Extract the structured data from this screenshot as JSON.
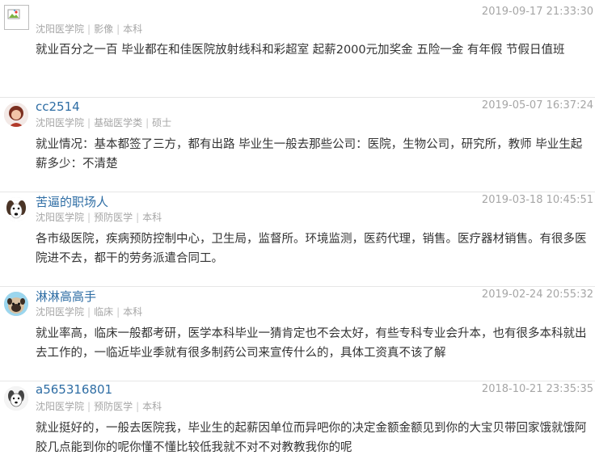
{
  "comments": [
    {
      "username": "",
      "school": "沈阳医学院",
      "major": "影像",
      "degree": "本科",
      "time": "2019-09-17 21:33:30",
      "content": "就业百分之一百 毕业都在和佳医院放射线科和彩超室 起薪2000元加奖金 五险一金 有年假 节假日值班",
      "avatar": "broken-image-icon"
    },
    {
      "username": "cc2514",
      "school": "沈阳医学院",
      "major": "基础医学类",
      "degree": "硕士",
      "time": "2019-05-07 16:37:24",
      "content": "就业情况：基本都签了三方，都有出路 毕业生一般去那些公司：医院，生物公司，研究所，教师 毕业生起薪多少：不清楚",
      "avatar": "user-avatar-icon"
    },
    {
      "username": "苦逼的职场人",
      "school": "沈阳医学院",
      "major": "预防医学",
      "degree": "本科",
      "time": "2019-03-18 10:45:51",
      "content": "各市级医院，疾病预防控制中心，卫生局，监督所。环境监测，医药代理，销售。医疗器材销售。有很多医院进不去，都干的劳务派遣合同工。",
      "avatar": "dog-avatar-icon"
    },
    {
      "username": "淋淋高高手",
      "school": "沈阳医学院",
      "major": "临床",
      "degree": "本科",
      "time": "2019-02-24 20:55:32",
      "content": "就业率高，临床一般都考研，医学本科毕业一猜肯定也不会太好，有些专科专业会升本，也有很多本科就出去工作的，一临近毕业季就有很多制药公司来宣传什么的，具体工资真不该了解",
      "avatar": "pug-avatar-icon"
    },
    {
      "username": "a565316801",
      "school": "沈阳医学院",
      "major": "预防医学",
      "degree": "本科",
      "time": "2018-10-21 23:35:35",
      "content": "就业挺好的，一般去医院我，毕业生的起薪因单位而异吧你的决定金额金额见到你的大宝贝带回家饿就饿阿胶几点能到你的呢你懂不懂比较低我就不对不对教教我你的呢",
      "avatar": "dog-sketch-avatar-icon"
    }
  ],
  "separator": "|"
}
